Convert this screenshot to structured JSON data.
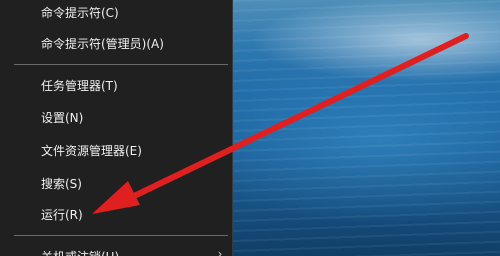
{
  "menu": {
    "items": [
      {
        "label": "命令提示符(C)"
      },
      {
        "label": "命令提示符(管理员)(A)"
      },
      {
        "label": "任务管理器(T)"
      },
      {
        "label": "设置(N)"
      },
      {
        "label": "文件资源管理器(E)"
      },
      {
        "label": "搜索(S)"
      },
      {
        "label": "运行(R)"
      },
      {
        "label": "关机或注销(U)"
      }
    ]
  },
  "annotation": {
    "arrow_color": "#e02020"
  }
}
